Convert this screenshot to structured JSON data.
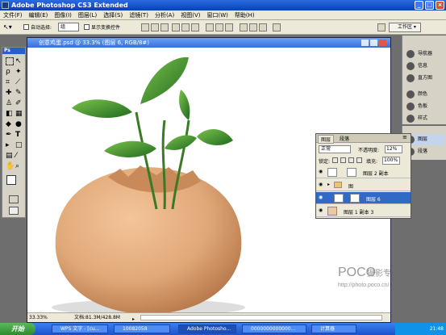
{
  "app": {
    "title": "Adobe Photoshop CS3 Extended"
  },
  "menu": [
    "文件(F)",
    "编辑(E)",
    "图像(I)",
    "图层(L)",
    "选择(S)",
    "滤镜(T)",
    "分析(A)",
    "视图(V)",
    "窗口(W)",
    "帮助(H)"
  ],
  "options": {
    "auto_select_label": "自动选择:",
    "auto_select_value": "组",
    "show_transform_label": "显示变换控件",
    "workspace_label": "工作区"
  },
  "document": {
    "title": "创意鸡蛋.psd @ 33.3% (图层 6, RGB/8#)",
    "zoom": "33.33%",
    "doc_info": "文档:81.3M/428.8M"
  },
  "layers_panel": {
    "tabs": [
      "图层",
      "段落"
    ],
    "blend_mode": "正常",
    "opacity_label": "不透明度:",
    "opacity_value": "12%",
    "lock_label": "锁定:",
    "fill_label": "填充:",
    "fill_value": "100%",
    "rows": [
      {
        "name": "图层 2 副本",
        "selected": false
      },
      {
        "name": "图",
        "selected": false
      },
      {
        "name": "图层 6",
        "selected": true
      },
      {
        "name": "图层 1 副本 3",
        "selected": false
      }
    ]
  },
  "dock1": [
    "导航器",
    "信息",
    "直方图",
    "颜色",
    "色板",
    "样式"
  ],
  "dock2": [
    "图层",
    "段落"
  ],
  "watermark": {
    "brand": "POCO",
    "text": "摄影专题",
    "url": "http://photo.poco.cn/"
  },
  "taskbar": {
    "start": "开始",
    "tasks": [
      "WPS 文字 - [cu...",
      "10082058",
      "Adobe Photosho...",
      "0000000000000...",
      "计算器"
    ],
    "clock": "21:48"
  },
  "colors": {
    "titlebar": "#0a3fb8",
    "selected_layer": "#316ac5",
    "egg": "#e0a878",
    "leaf": "#3c9a2e"
  }
}
